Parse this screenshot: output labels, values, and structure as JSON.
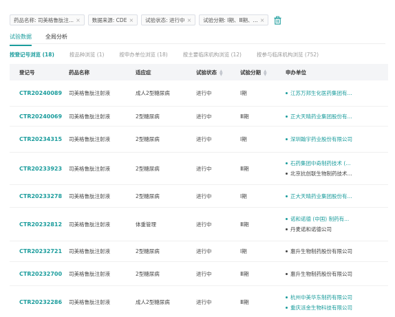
{
  "filters": [
    {
      "label": "药品名称: 司美格鲁肽注..."
    },
    {
      "label": "数据来源: CDE"
    },
    {
      "label": "试验状态: 进行中"
    },
    {
      "label": "试验分期: Ⅰ期、Ⅲ期、..."
    }
  ],
  "tabs": [
    {
      "label": "试验数据",
      "active": true
    },
    {
      "label": "全局分析",
      "active": false
    }
  ],
  "subtabs": [
    {
      "label": "按登记号浏览 (18)",
      "active": true
    },
    {
      "label": "按品种浏览 (1)",
      "active": false
    },
    {
      "label": "按申办单位浏览 (18)",
      "active": false
    },
    {
      "label": "按主要临床机构浏览 (12)",
      "active": false
    },
    {
      "label": "按参与临床机构浏览 (752)",
      "active": false
    }
  ],
  "table": {
    "headers": [
      "登记号",
      "药品名称",
      "适应症",
      "试验状态",
      "试验分期",
      "申办单位"
    ],
    "rows": [
      {
        "id": "CTR20240089",
        "drug": "司美格鲁肽注射液",
        "ind": "成人2型糖尿病",
        "status": "进行中",
        "phase": "Ⅰ期",
        "units": [
          "江苏万邦生化医药集团有..."
        ],
        "colored": true,
        "h": 38
      },
      {
        "id": "CTR20240069",
        "drug": "司美格鲁肽注射液",
        "ind": "2型糖尿病",
        "status": "进行中",
        "phase": "Ⅲ期",
        "units": [
          "正大天晴药业集团股份有..."
        ],
        "colored": true,
        "h": 29
      },
      {
        "id": "CTR20234315",
        "drug": "司美格鲁肽注射液",
        "ind": "2型糖尿病",
        "status": "进行中",
        "phase": "Ⅰ期",
        "units": [
          "深圳翰宇药业股份有限公司"
        ],
        "colored": true,
        "h": 38
      },
      {
        "id": "CTR20233923",
        "drug": "司美格鲁肽注射液",
        "ind": "2型糖尿病",
        "status": "进行中",
        "phase": "Ⅲ期",
        "units": [
          "石药集团中奇制药技术 (...",
          "北京抗创联生物制药技术..."
        ],
        "colored": false,
        "h": 47
      },
      {
        "id": "CTR20233278",
        "drug": "司美格鲁肽注射液",
        "ind": "2型糖尿病",
        "status": "进行中",
        "phase": "Ⅰ期",
        "units": [
          "正大天晴药业集团股份有..."
        ],
        "colored": true,
        "h": 33
      },
      {
        "id": "CTR20232812",
        "drug": "司美格鲁肽注射液",
        "ind": "体重管理",
        "status": "进行中",
        "phase": "Ⅲ期",
        "units": [
          "诺和诺德 (中国) 制药有...",
          "丹麦诺和诺德公司"
        ],
        "colored": false,
        "h": 49
      },
      {
        "id": "CTR20232721",
        "drug": "司美格鲁肽注射液",
        "ind": "2型糖尿病",
        "status": "进行中",
        "phase": "Ⅰ期",
        "units": [
          "惠升生物制药股份有限公司"
        ],
        "colored": false,
        "h": 30
      },
      {
        "id": "CTR20232700",
        "drug": "司美格鲁肽注射液",
        "ind": "2型糖尿病",
        "status": "进行中",
        "phase": "Ⅲ期",
        "units": [
          "惠升生物制药股份有限公司"
        ],
        "colored": false,
        "h": 35
      },
      {
        "id": "CTR20232286",
        "drug": "司美格鲁肽注射液",
        "ind": "成人2型糖尿病",
        "status": "进行中",
        "phase": "Ⅲ期",
        "units": [
          "杭州中美华东制药有限公司",
          "重庆派金生物科技有限公司"
        ],
        "colored": true,
        "h": 48
      }
    ]
  },
  "colors": {
    "accent": "#1a9c9c"
  }
}
